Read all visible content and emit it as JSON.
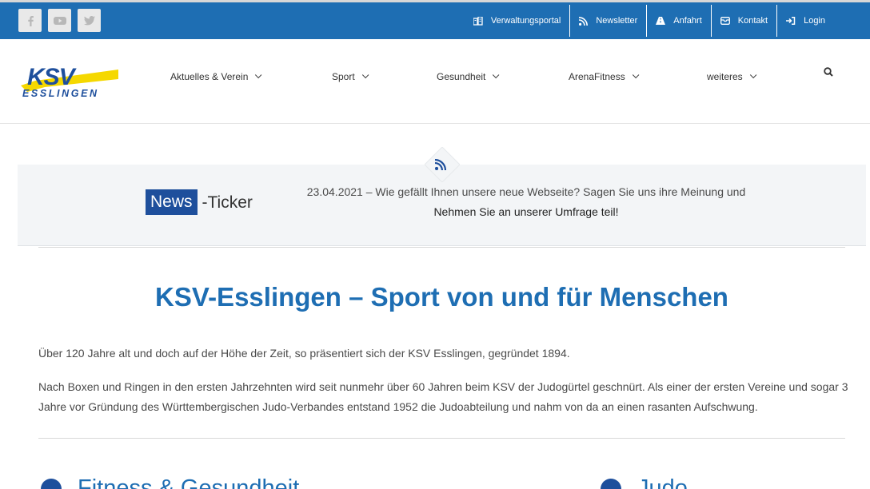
{
  "topbar": {
    "social": [
      {
        "name": "facebook-icon"
      },
      {
        "name": "youtube-icon"
      },
      {
        "name": "twitter-icon"
      }
    ],
    "links": [
      {
        "label": "Verwaltungsportal",
        "icon": "portal-icon"
      },
      {
        "label": "Newsletter",
        "icon": "rss-icon"
      },
      {
        "label": "Anfahrt",
        "icon": "road-icon"
      },
      {
        "label": "Kontakt",
        "icon": "envelope-icon"
      },
      {
        "label": "Login",
        "icon": "sign-in-icon"
      }
    ],
    "color": "#1e6eb3"
  },
  "logo": {
    "main": "KSV",
    "sub": "ESSLINGEN",
    "colors": [
      "#1e4f9c",
      "#f5d800"
    ]
  },
  "nav": {
    "items": [
      {
        "label": "Aktuelles & Verein"
      },
      {
        "label": "Sport"
      },
      {
        "label": "Gesundheit"
      },
      {
        "label": "ArenaFitness"
      },
      {
        "label": "weiteres"
      }
    ]
  },
  "ticker": {
    "label_box": "News",
    "label_rest": "-Ticker",
    "text": "23.04.2021 – Wie gefällt Ihnen unsere neue Webseite? Sagen Sie uns ihre Meinung und",
    "link": "Nehmen Sie an unserer Umfrage teil!"
  },
  "main": {
    "title": "KSV-Esslingen – Sport von und für Menschen",
    "para1": "Über 120 Jahre alt und doch auf der Höhe der Zeit, so präsentiert sich der KSV Esslingen, gegründet 1894.",
    "para2": "Nach Boxen und Ringen in den ersten Jahrzehnten wird seit nunmehr über 60 Jahren beim KSV der Judogürtel geschnürt. Als einer der ersten Vereine und sogar 3 Jahre vor Gründung des Württembergischen Judo-Verbandes entstand 1952 die Judoabteilung und nahm von da an einen rasanten Aufschwung.",
    "sections": [
      {
        "label": "Fitness & Gesundheit"
      },
      {
        "label": "Judo"
      }
    ]
  }
}
